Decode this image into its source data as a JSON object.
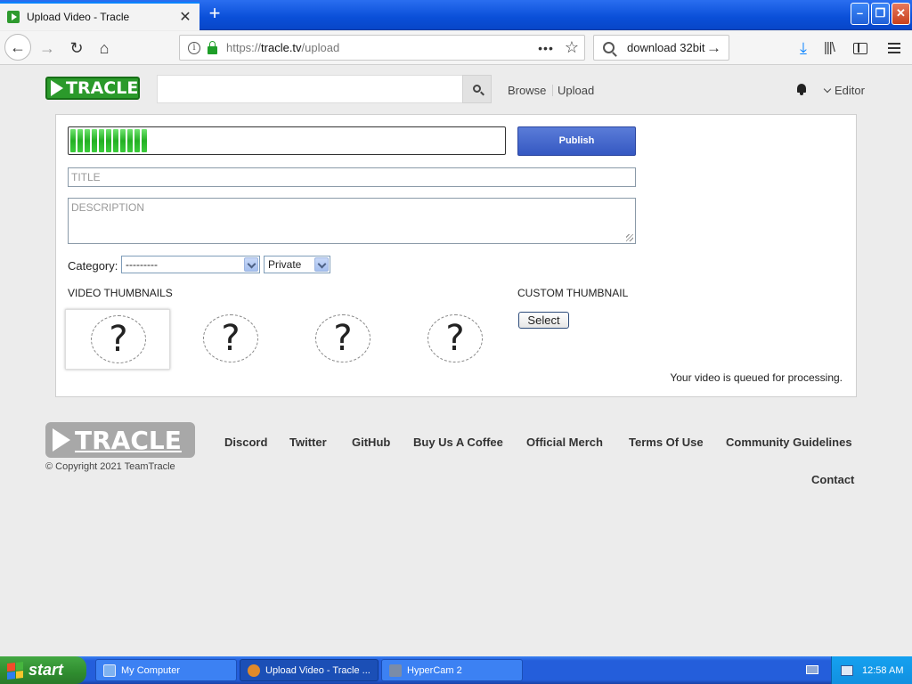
{
  "browser": {
    "tab_title": "Upload Video - Tracle",
    "tab_close": "✕",
    "new_tab": "+",
    "url_prefix": "https://",
    "url_host": "tracle.tv",
    "url_path": "/upload",
    "url_more": "•••",
    "url_star": "☆",
    "search_text": "download 32bit",
    "search_go": "→",
    "back": "←",
    "forward": "→",
    "reload": "↻",
    "home": "⌂",
    "info": "i",
    "download": "⤓",
    "library": "|||\\",
    "win_min": "–",
    "win_max": "❐",
    "win_close": "✕"
  },
  "site": {
    "logo_text": "TRACLE",
    "nav": {
      "browse": "Browse",
      "upload": "Upload",
      "editor": "Editor"
    }
  },
  "upload": {
    "progress_fraction": 0.19,
    "publish_label": "Publish",
    "title_placeholder": "TITLE",
    "description_placeholder": "DESCRIPTION",
    "category_label": "Category:",
    "category_value": "---------",
    "privacy_value": "Private",
    "video_thumbnails_heading": "VIDEO THUMBNAILS",
    "custom_thumbnail_heading": "CUSTOM THUMBNAIL",
    "thumbnail_placeholder": "?",
    "select_label": "Select",
    "status_message": "Your video is queued for processing."
  },
  "footer": {
    "logo_text": "TRACLE",
    "copyright": "© Copyright 2021 TeamTracle",
    "links": {
      "discord": "Discord",
      "twitter": "Twitter",
      "github": "GitHub",
      "coffee": "Buy Us A Coffee",
      "merch": "Official Merch",
      "terms": "Terms Of Use",
      "guidelines": "Community Guidelines",
      "contact": "Contact"
    }
  },
  "taskbar": {
    "start_label": "start",
    "tasks": [
      "My Computer",
      "Upload Video - Tracle ...",
      "HyperCam 2"
    ],
    "clock": "12:58 AM"
  },
  "colors": {
    "brand_green": "#2b9a2b",
    "publish_blue": "#3558c2",
    "progress_green": "#23b023",
    "xp_blue": "#245edb"
  }
}
